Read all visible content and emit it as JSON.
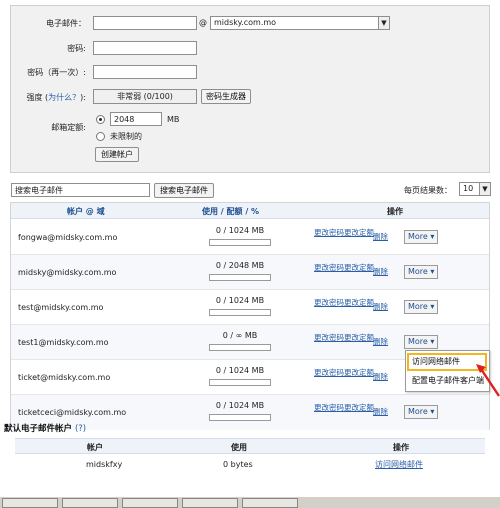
{
  "form": {
    "email_label": "电子邮件：",
    "email_value": "",
    "at_sign": "@",
    "domain_value": "midsky.com.mo",
    "password_label": "密码:",
    "password_confirm_label": "密码（再一次）:",
    "strength_label_prefix": "强度 (",
    "strength_help_link": "为什么？",
    "strength_label_suffix": "):",
    "strength_value": "非常弱 (0/100)",
    "password_generator_button": "密码生成器",
    "quota_label": "邮箱定额:",
    "quota_value": "2048",
    "quota_unit": "MB",
    "unlimited_label": "未限制的",
    "create_button": "创建帐户"
  },
  "search": {
    "input_value": "搜索电子邮件",
    "button": "搜索电子邮件",
    "per_page_label": "每页结果数：",
    "per_page_value": "10"
  },
  "table": {
    "col_account": "帐户 @ 域",
    "col_usage_a": "使用",
    "col_usage_sep1": "/",
    "col_usage_b": "配额",
    "col_usage_sep2": "/",
    "col_usage_c": "%",
    "col_actions": "操作",
    "action_change_password": "更改密码",
    "action_change_quota": "更改定额",
    "action_delete": "删除",
    "more_label": "More ▾",
    "rows": [
      {
        "account": "fongwa@midsky.com.mo",
        "usage": "0 / 1024 MB"
      },
      {
        "account": "midsky@midsky.com.mo",
        "usage": "0 / 2048 MB"
      },
      {
        "account": "test@midsky.com.mo",
        "usage": "0 / 1024 MB"
      },
      {
        "account": "test1@midsky.com.mo",
        "usage": "0 / ∞ MB"
      },
      {
        "account": "ticket@midsky.com.mo",
        "usage": "0 / 1024 MB"
      },
      {
        "account": "ticketceci@midsky.com.mo",
        "usage": "0 / 1024 MB"
      }
    ]
  },
  "more_menu": {
    "item1": "访问网络邮件",
    "item2": "配置电子邮件客户端"
  },
  "default_account": {
    "title": "默认电子邮件帐户",
    "help": "(?)",
    "col_account": "帐户",
    "col_usage": "使用",
    "col_actions": "操作",
    "account": "midskfxy",
    "usage": "0 bytes",
    "action": "访问网络邮件"
  },
  "colors": {
    "header_blue": "#1f4f8f",
    "link_blue": "#2a5fa8",
    "highlight": "#f3b61d",
    "arrow_red": "#e02020"
  }
}
